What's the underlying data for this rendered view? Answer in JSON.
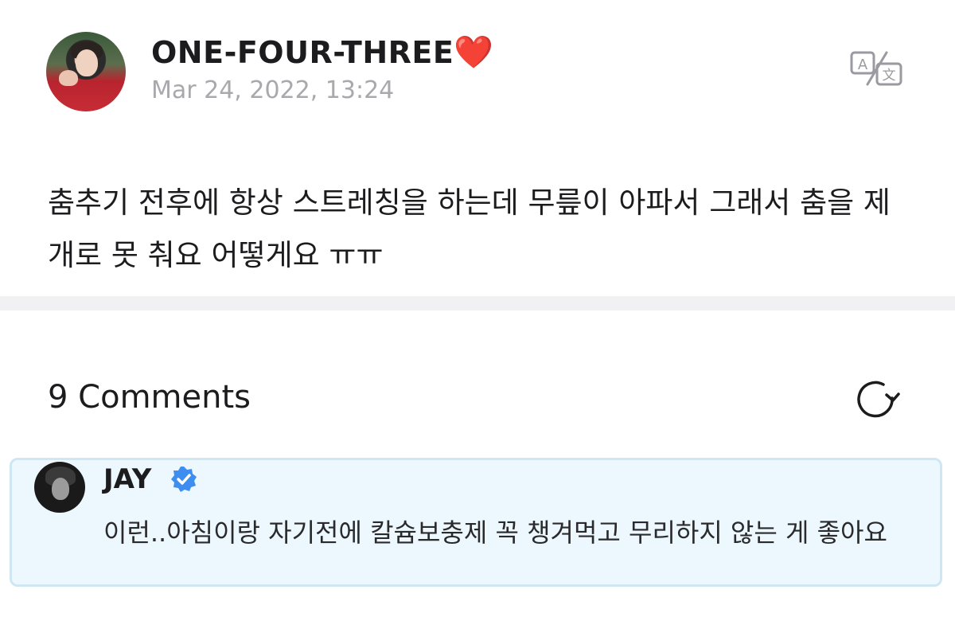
{
  "post": {
    "author": "ONE-FOUR-THREE",
    "author_emoji": "❤️",
    "date": "Mar 24, 2022, 13:24",
    "body": "춤추기 전후에 항상 스트레칭을 하는데 무릎이 아파서 그래서 춤을 제개로 못 춰요 어떻게요 ㅠㅠ"
  },
  "comments": {
    "title": "9 Comments",
    "items": [
      {
        "author": "JAY",
        "verified": true,
        "text": "이런..아침이랑 자기전에 칼슘보충제 꼭 챙겨먹고 무리하지 않는 게 좋아요"
      }
    ]
  },
  "icons": {
    "translate": "translate-icon",
    "refresh": "refresh-icon",
    "verified": "verified-badge-icon"
  },
  "colors": {
    "verified": "#3d8ef0",
    "comment_bg": "#ecf8fd",
    "comment_border": "#cfe7f2",
    "date": "#a8a8ad"
  }
}
